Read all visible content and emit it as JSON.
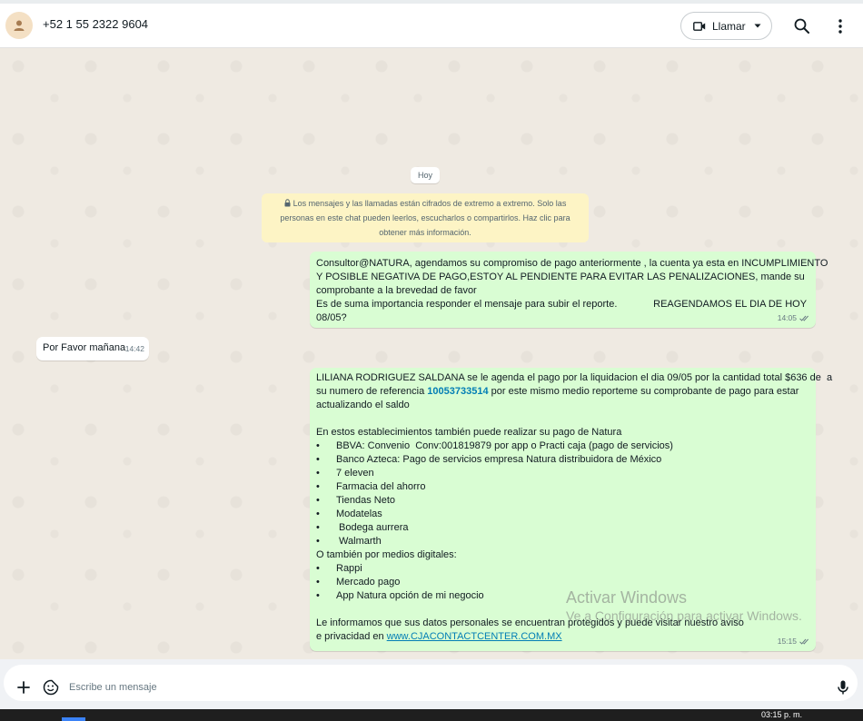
{
  "header": {
    "contact": "+52 1 55 2322 9604",
    "call_label": "Llamar"
  },
  "chat": {
    "day_label": "Hoy",
    "encryption_notice": [
      "Los mensajes y las llamadas están cifrados de extremo a extremo. Solo las",
      "personas en este chat pueden leerlos, escucharlos o compartirlos. Haz clic para",
      "obtener más información."
    ],
    "messages": [
      {
        "direction": "out",
        "lines": [
          "Consultor@NATURA, agendamos su compromiso de pago anteriormente , la cuenta ya esta en INCUMPLIMIENTO",
          "Y POSIBLE NEGATIVA DE PAGO,ESTOY AL PENDIENTE PARA EVITAR LAS PENALIZACIONES, mande su",
          "comprobante a la brevedad de favor",
          "Es de suma importancia responder el mensaje para subir el reporte.             REAGENDAMOS EL DIA DE HOY",
          "08/05?"
        ],
        "time": "14:05"
      },
      {
        "direction": "in",
        "text": "Por Favor mañana",
        "time": "14:42"
      },
      {
        "direction": "out",
        "intro_1": "LILIANA RODRIGUEZ SALDANA se le agenda el pago por la liquidacion el dia 09/05 por la cantidad total $636 de  a",
        "intro_2_pre": "su numero de referencia ",
        "reference": "10053733514",
        "intro_2_post": " por este mismo medio reporteme su comprobante de pago para estar",
        "intro_3": "actualizando el saldo",
        "stores_heading": "En estos establecimientos también puede realizar su pago de Natura",
        "bullet": "•",
        "stores": [
          "BBVA: Convenio  Conv:001819879 por app o Practi caja (pago de servicios)",
          "Banco Azteca: Pago de servicios empresa Natura distribuidora de México",
          "7 eleven",
          "Farmacia del ahorro",
          "Tiendas Neto",
          "Modatelas",
          " Bodega aurrera",
          " Walmarth"
        ],
        "digital_heading": "O también por medios digitales:",
        "digital": [
          "Rappi",
          "Mercado pago",
          "App Natura opción de mi negocio"
        ],
        "privacy_1": "Le informamos que sus datos personales se encuentran protegidos y puede visitar nuestro aviso",
        "privacy_2_pre": "e privacidad en ",
        "privacy_link": "www.CJACONTACTCENTER.COM.MX",
        "time": "15:15"
      }
    ]
  },
  "composer": {
    "placeholder": "Escribe un mensaje"
  },
  "watermark": {
    "title": "Activar Windows",
    "subtitle": "Ve a Configuración para activar Windows."
  },
  "taskbar": {
    "clock": "03:15 p. m."
  },
  "colors": {
    "outgoing_bubble": "#d9fdd3",
    "incoming_bubble": "#ffffff",
    "chat_background": "#efeae2",
    "notice_background": "#fdf4c5",
    "link": "#027eb5"
  },
  "icons": [
    "person-icon",
    "video-icon",
    "caret-down-icon",
    "search-icon",
    "kebab-menu-icon",
    "lock-icon",
    "double-check-icon",
    "plus-icon",
    "sticker-icon",
    "microphone-icon"
  ]
}
